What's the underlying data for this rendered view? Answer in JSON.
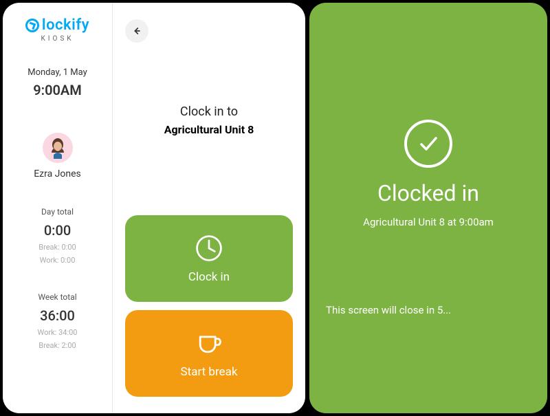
{
  "brand": {
    "name": "lockify",
    "kiosk": "KIOSK"
  },
  "sidebar": {
    "date": "Monday, 1 May",
    "time": "9:00AM",
    "user_name": "Ezra Jones",
    "day": {
      "label": "Day total",
      "value": "0:00",
      "break": "Break: 0:00",
      "work": "Work: 0:00"
    },
    "week": {
      "label": "Week total",
      "value": "36:00",
      "work": "Work: 34:00",
      "break": "Break: 2:00"
    }
  },
  "main": {
    "heading_title": "Clock in to",
    "heading_subject": "Agricultural Unit 8",
    "clock_in_label": "Clock in",
    "break_label": "Start break"
  },
  "confirmation": {
    "title": "Clocked in",
    "detail": "Agricultural Unit 8 at 9:00am",
    "closing": "This screen will close in 5..."
  }
}
